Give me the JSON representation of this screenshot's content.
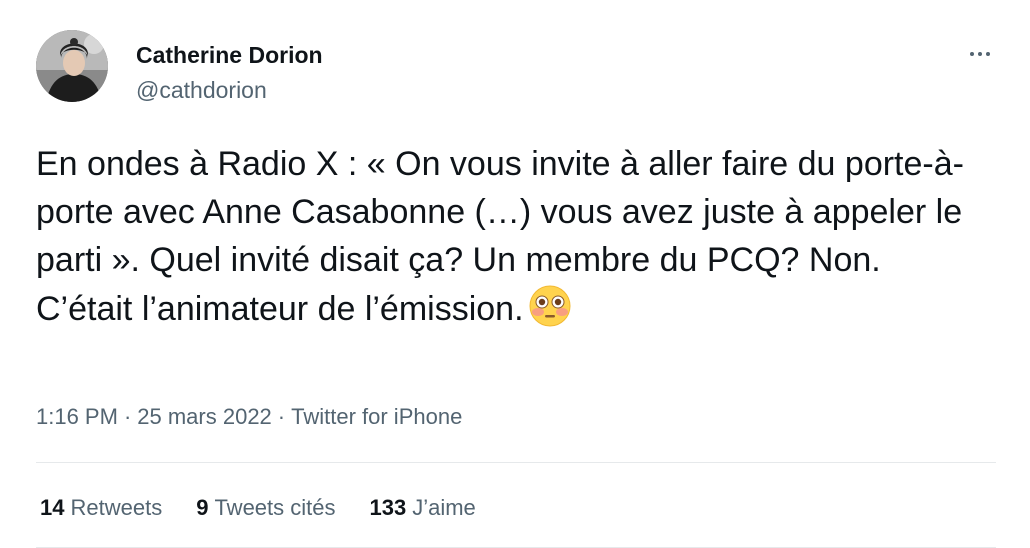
{
  "author": {
    "name": "Catherine Dorion",
    "handle": "@cathdorion",
    "avatar_icon": "profile-photo-woman-beanie"
  },
  "tweet": {
    "text": "En ondes à Radio X : « On vous invite à aller faire du porte-à-porte avec Anne Casabonne (…) vous avez juste à appeler le parti ». Quel invité disait ça? Un membre du PCQ? Non. C’était l’animateur de l’émission.",
    "emoji": "flushed-face-emoji",
    "time": "1:16 PM",
    "date": "25 mars 2022",
    "source": "Twitter for iPhone",
    "separator": "·"
  },
  "stats": {
    "retweets_count": "14",
    "retweets_label": "Retweets",
    "quotes_count": "9",
    "quotes_label": "Tweets cités",
    "likes_count": "133",
    "likes_label": "J’aime"
  },
  "colors": {
    "text_primary": "#0f1419",
    "text_secondary": "#536471",
    "divider": "#e6e9eb"
  }
}
